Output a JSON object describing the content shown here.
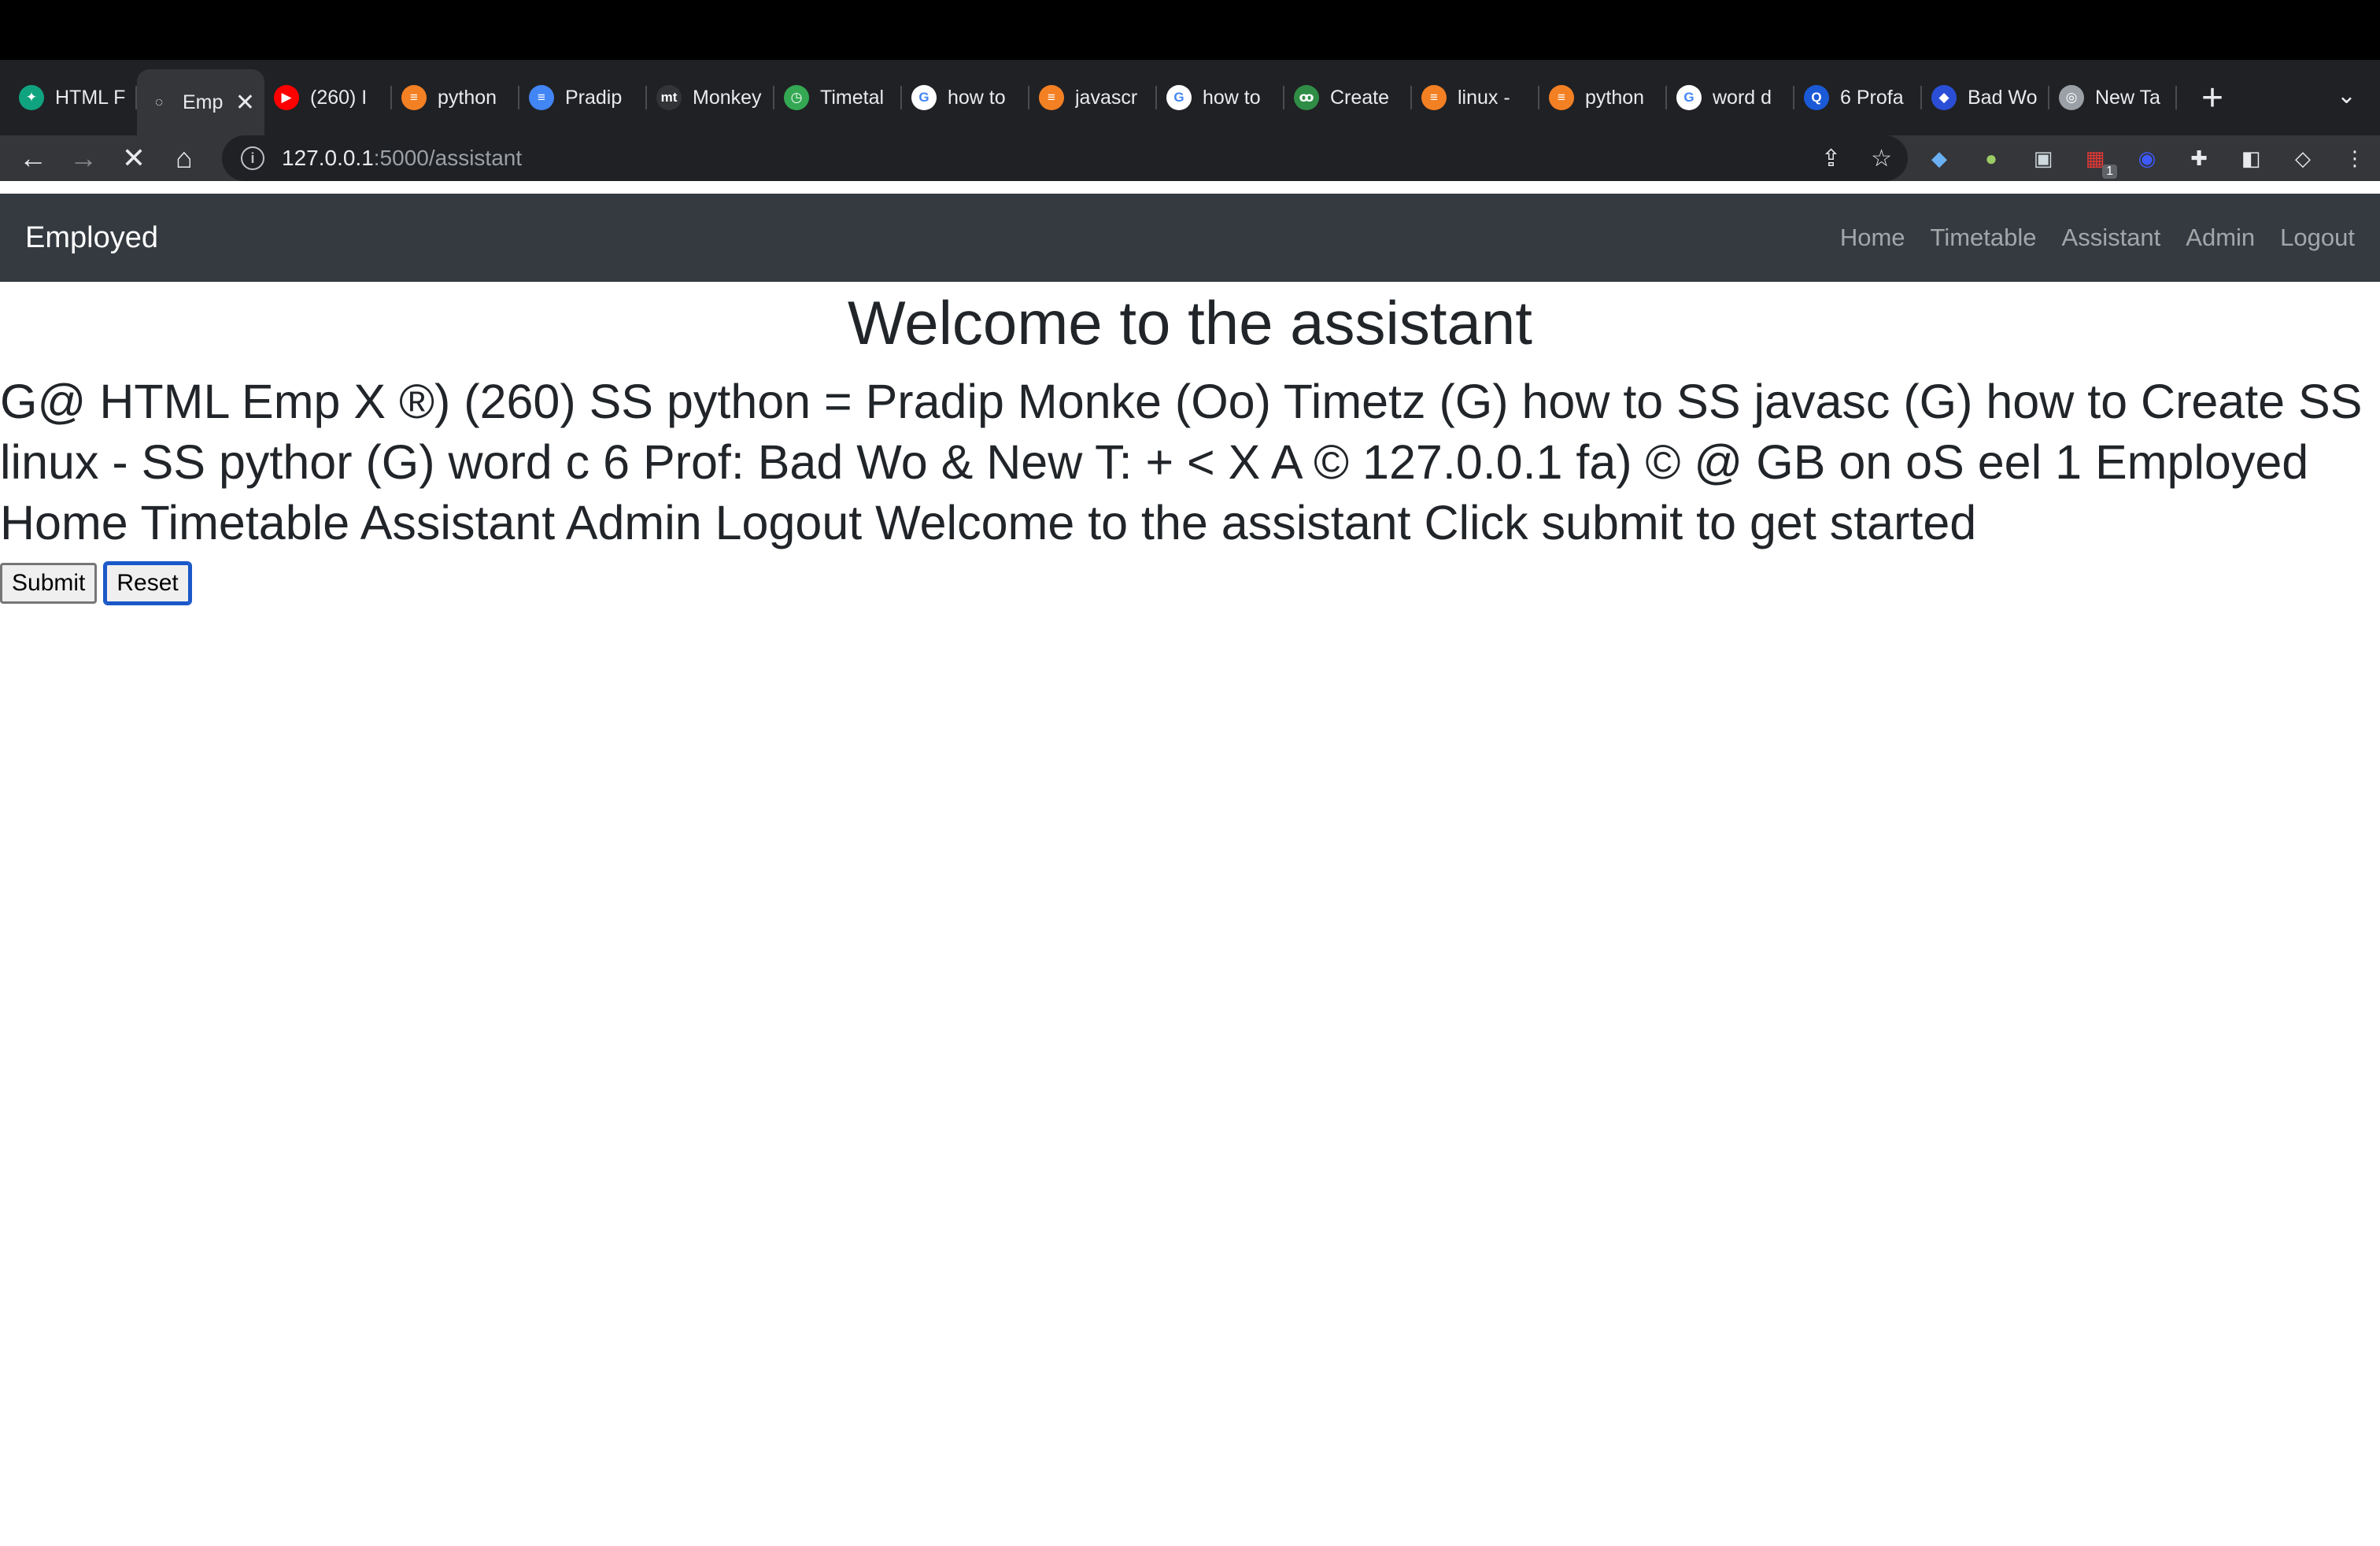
{
  "browser": {
    "tabs": [
      {
        "title": "HTML F",
        "icon": "chatgpt-icon",
        "color": "#10a37f",
        "glyph": "✦"
      },
      {
        "title": "Emp",
        "icon": "loading-icon",
        "color": "#35363a",
        "glyph": "◌",
        "active": true
      },
      {
        "title": "(260) I",
        "icon": "youtube-icon",
        "color": "#ff0000",
        "glyph": "▶"
      },
      {
        "title": "python",
        "icon": "stackoverflow-icon",
        "color": "#f48024",
        "glyph": "≡"
      },
      {
        "title": "Pradip",
        "icon": "google-docs-icon",
        "color": "#4285f4",
        "glyph": "≡"
      },
      {
        "title": "Monkey",
        "icon": "monkeytype-icon",
        "color": "#323437",
        "glyph": "mt"
      },
      {
        "title": "Timetal",
        "icon": "timetable-icon",
        "color": "#34a853",
        "glyph": "◷"
      },
      {
        "title": "how to",
        "icon": "google-icon",
        "color": "#ffffff",
        "glyph": "G"
      },
      {
        "title": "javascr",
        "icon": "stackoverflow-icon",
        "color": "#f48024",
        "glyph": "≡"
      },
      {
        "title": "how to",
        "icon": "google-icon",
        "color": "#ffffff",
        "glyph": "G"
      },
      {
        "title": "Create",
        "icon": "geeksforgeeks-icon",
        "color": "#2f8d46",
        "glyph": "ꝏ"
      },
      {
        "title": "linux - ",
        "icon": "stackoverflow-icon",
        "color": "#f48024",
        "glyph": "≡"
      },
      {
        "title": "python",
        "icon": "stackoverflow-icon",
        "color": "#f48024",
        "glyph": "≡"
      },
      {
        "title": "word d",
        "icon": "google-icon",
        "color": "#ffffff",
        "glyph": "G"
      },
      {
        "title": "6 Profa",
        "icon": "profanity-icon",
        "color": "#1a5ad7",
        "glyph": "Q"
      },
      {
        "title": "Bad Wo",
        "icon": "badwords-icon",
        "color": "#2a4fd6",
        "glyph": "◆"
      },
      {
        "title": "New Ta",
        "icon": "chrome-icon",
        "color": "#9aa0a6",
        "glyph": "◎"
      }
    ],
    "url_host": "127.0.0.1",
    "url_path": ":5000/assistant",
    "extension_badge": "1"
  },
  "app": {
    "brand": "Employed",
    "nav": [
      "Home",
      "Timetable",
      "Assistant",
      "Admin",
      "Logout"
    ]
  },
  "main": {
    "title": "Welcome to the assistant",
    "output_text": "G@ HTML Emp X ®) (260) SS python = Pradip Monke (Oo) Timetz (G) how to SS javasc (G) how to Create SS linux - SS pythor (G) word c 6 Prof: Bad Wo & New T: + < X A © 127.0.0.1 fa) © @ GB on oS eel 1 Employed Home Timetable Assistant Admin Logout Welcome to the assistant Click submit to get started",
    "submit_label": "Submit",
    "reset_label": "Reset"
  }
}
